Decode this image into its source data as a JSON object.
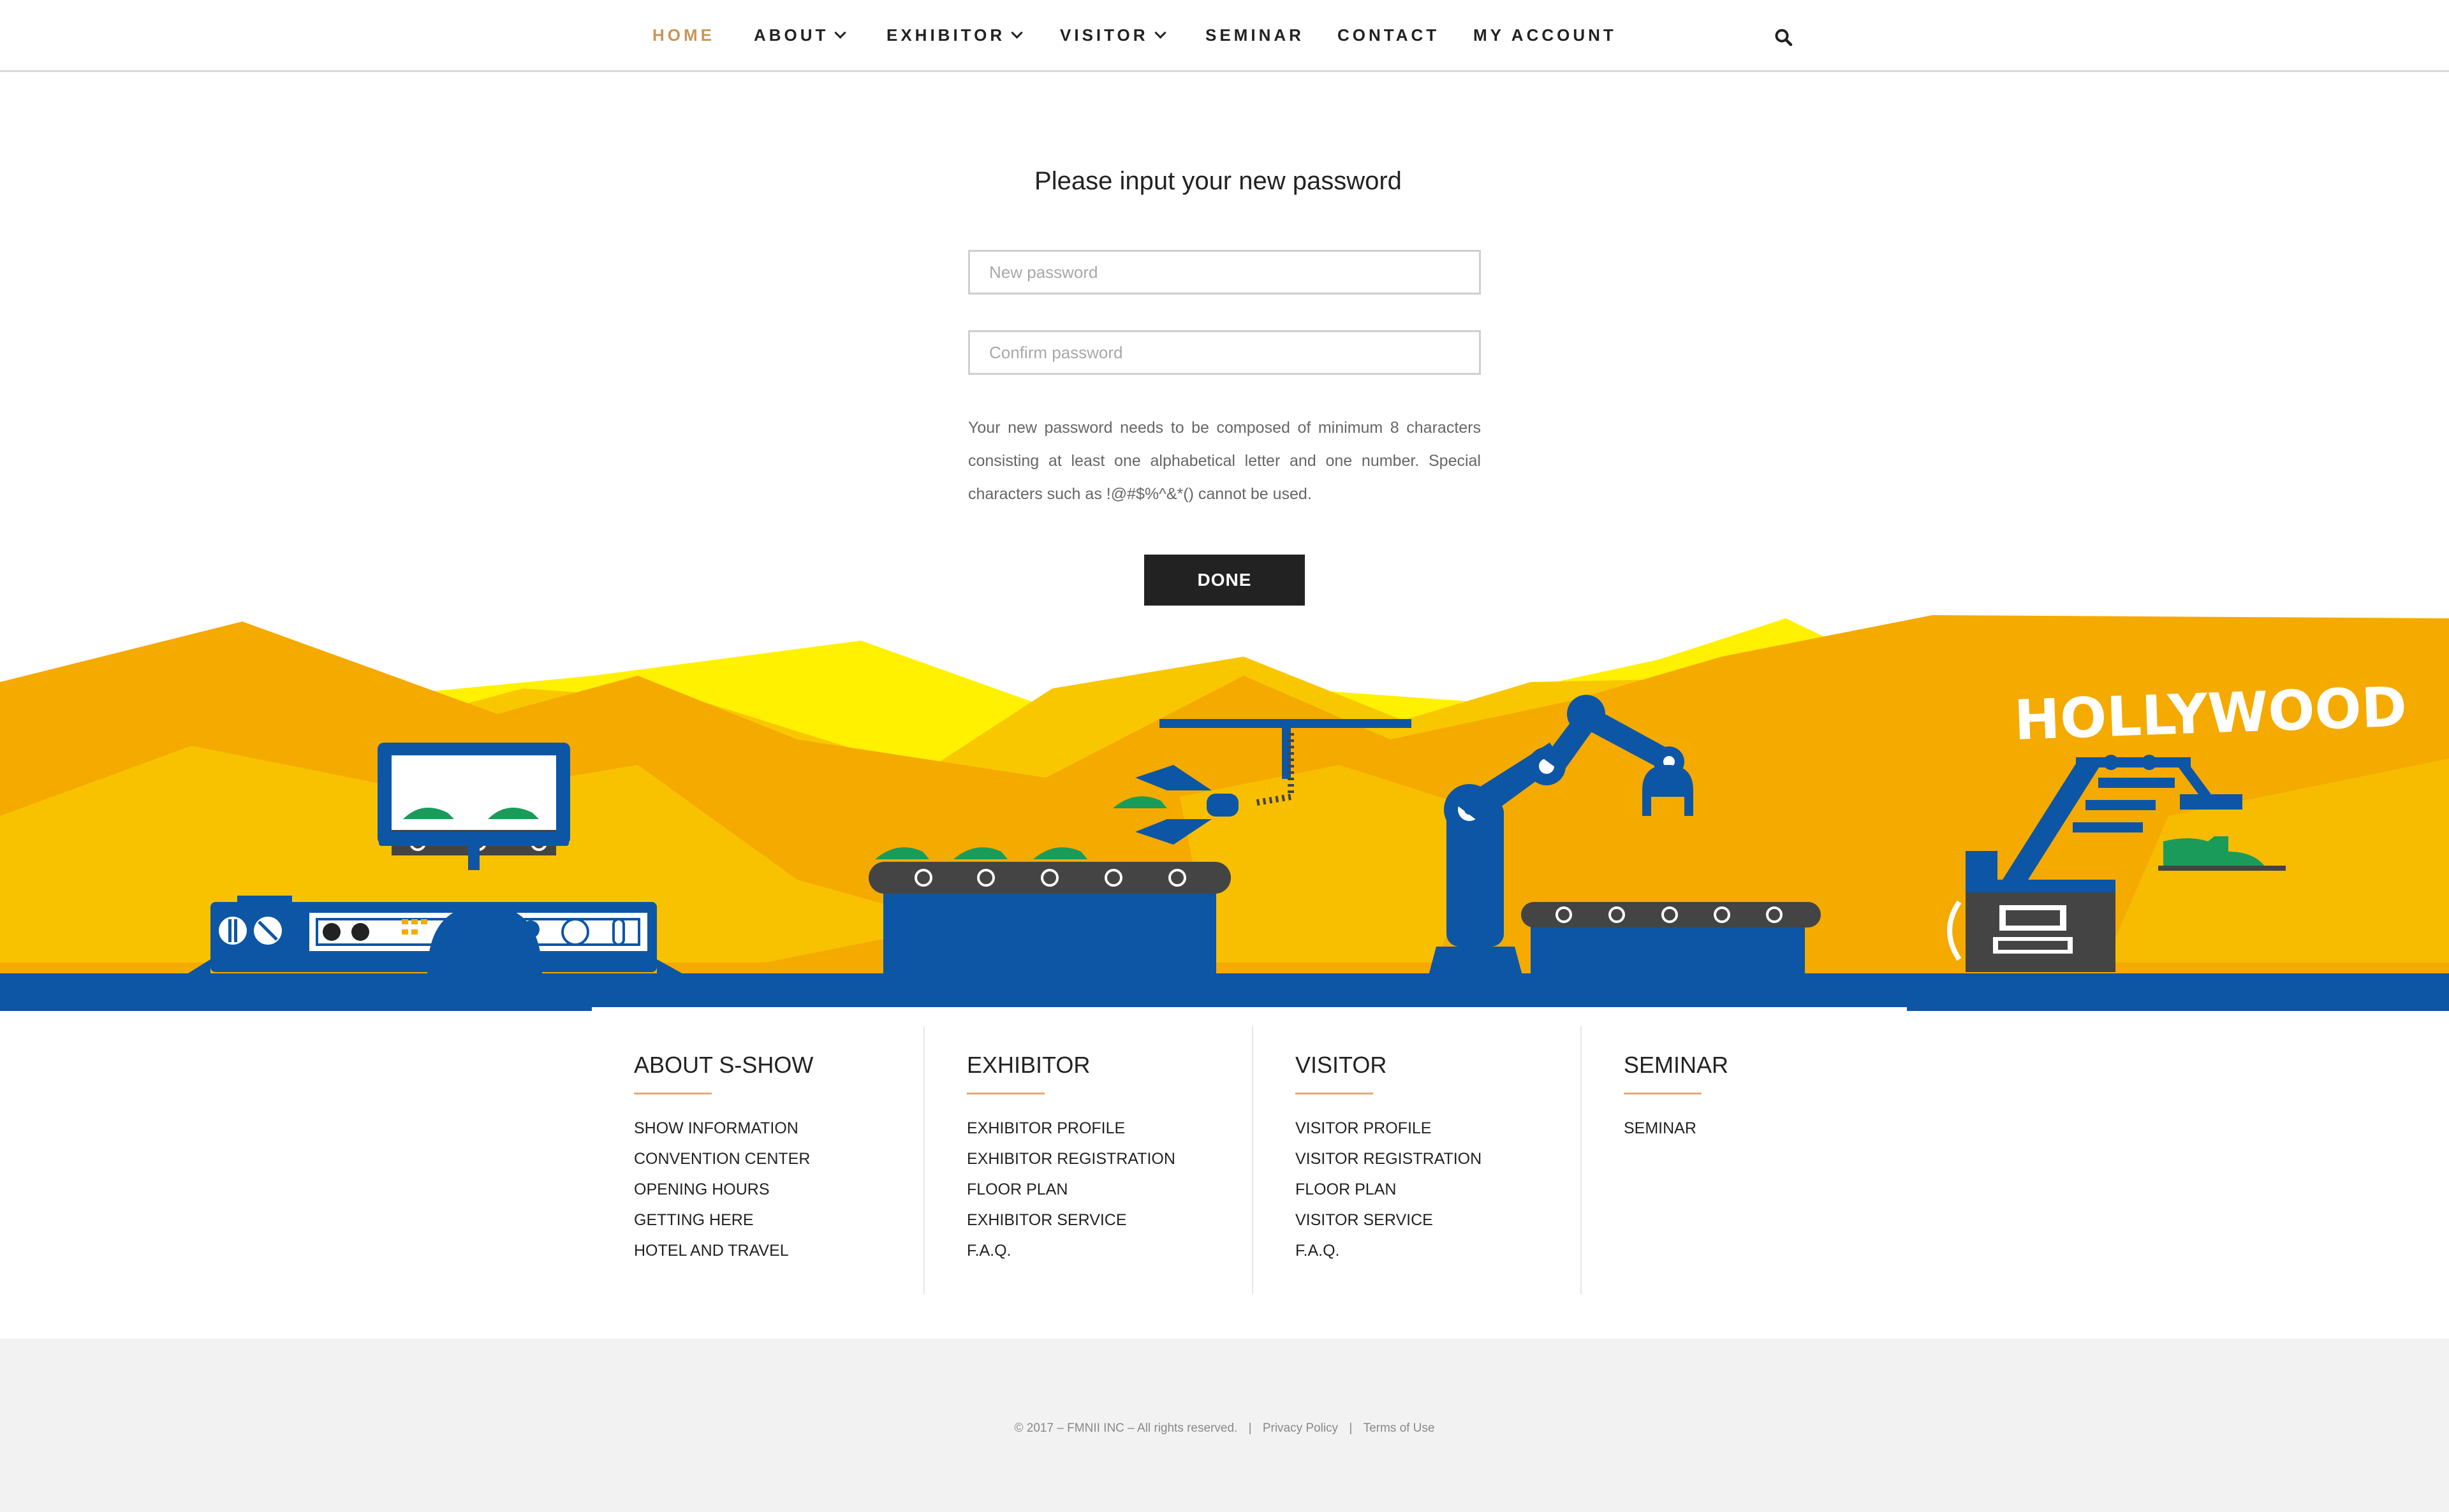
{
  "nav": {
    "items": [
      {
        "label": "HOME",
        "active": true,
        "dropdown": false
      },
      {
        "label": "ABOUT",
        "active": false,
        "dropdown": true
      },
      {
        "label": "EXHIBITOR",
        "active": false,
        "dropdown": true
      },
      {
        "label": "VISITOR",
        "active": false,
        "dropdown": true
      },
      {
        "label": "SEMINAR",
        "active": false,
        "dropdown": false
      },
      {
        "label": "CONTACT",
        "active": false,
        "dropdown": false
      },
      {
        "label": "MY ACCOUNT",
        "active": false,
        "dropdown": false
      }
    ],
    "search_icon": "search-icon",
    "active_color": "#c8955a"
  },
  "form": {
    "title": "Please input your new password",
    "new_password_placeholder": "New password",
    "confirm_password_placeholder": "Confirm password",
    "hint": "Your new password needs to be composed of minimum 8 characters consisting at least one alphabetical letter and one number. Special characters such as !@#$%^&*() cannot be used.",
    "done_label": "DONE"
  },
  "illustration": {
    "sign_text": "HOLLYWOOD",
    "colors": {
      "yellow": "#fff100",
      "gold": "#f9c700",
      "orange": "#f5aa00",
      "blue": "#0d56a5",
      "dark": "#444444",
      "shoe_green": "#1b9b5a"
    }
  },
  "footer": {
    "columns": [
      {
        "title": "ABOUT S-SHOW",
        "links": [
          "SHOW INFORMATION",
          "CONVENTION CENTER",
          "OPENING HOURS",
          "GETTING HERE",
          "HOTEL AND TRAVEL"
        ]
      },
      {
        "title": "EXHIBITOR",
        "links": [
          "EXHIBITOR PROFILE",
          "EXHIBITOR REGISTRATION",
          "FLOOR PLAN",
          "EXHIBITOR SERVICE",
          "F.A.Q."
        ]
      },
      {
        "title": "VISITOR",
        "links": [
          "VISITOR PROFILE",
          "VISITOR REGISTRATION",
          "FLOOR PLAN",
          "VISITOR SERVICE",
          "F.A.Q."
        ]
      },
      {
        "title": "SEMINAR",
        "links": [
          "SEMINAR"
        ]
      }
    ],
    "accent_color": "#e0ab7a",
    "copyright": "© 2017 – FMNII INC – All rights reserved.",
    "separator": "|",
    "privacy": "Privacy Policy",
    "terms": "Terms of Use"
  }
}
